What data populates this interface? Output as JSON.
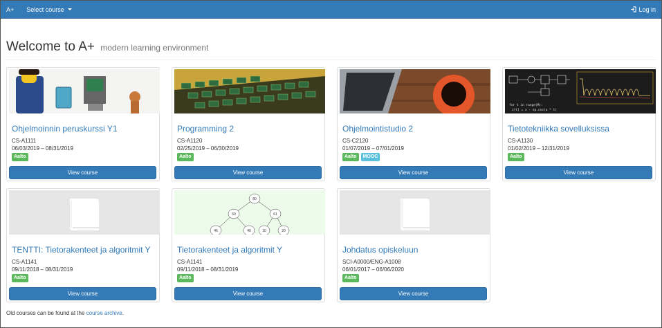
{
  "navbar": {
    "brand": "A+",
    "select_course": "Select course",
    "login": "Log in"
  },
  "header": {
    "title": "Welcome to A+",
    "subtitle": "modern learning environment"
  },
  "courses": [
    {
      "title": "Ohjelmoinnin peruskurssi Y1",
      "code": "CS-A1111",
      "dates": "06/03/2019 – 08/31/2019",
      "labels": [
        "Aalto"
      ],
      "button": "View course"
    },
    {
      "title": "Programming 2",
      "code": "CS-A1120",
      "dates": "02/25/2019 – 06/30/2019",
      "labels": [
        "Aalto"
      ],
      "button": "View course"
    },
    {
      "title": "Ohjelmointistudio 2",
      "code": "CS-C2120",
      "dates": "01/07/2019 – 07/01/2019",
      "labels": [
        "Aalto",
        "MOOC"
      ],
      "button": "View course"
    },
    {
      "title": "Tietotekniikka sovelluksissa",
      "code": "CS-A1130",
      "dates": "01/02/2019 – 12/31/2019",
      "labels": [
        "Aalto"
      ],
      "button": "View course"
    },
    {
      "title": "TENTTI: Tietorakenteet ja algoritmit Y",
      "code": "CS-A1141",
      "dates": "09/11/2018 – 08/31/2019",
      "labels": [
        "Aalto"
      ],
      "button": "View course"
    },
    {
      "title": "Tietorakenteet ja algoritmit Y",
      "code": "CS-A1141",
      "dates": "09/11/2018 – 08/31/2019",
      "labels": [
        "Aalto"
      ],
      "button": "View course"
    },
    {
      "title": "Johdatus opiskeluun",
      "code": "SCI-A0000/ENG-A1008",
      "dates": "06/01/2017 – 06/06/2020",
      "labels": [
        "Aalto"
      ],
      "button": "View course"
    }
  ],
  "thumbnail_text": {
    "code_line_1": "for t in range(M):",
    "code_line_2": "z[t] = x - np.cos(a * t)",
    "tree_nodes": [
      "80",
      "50",
      "61",
      "46",
      "40",
      "10",
      "20"
    ]
  },
  "footer": {
    "prefix": "Old courses can be found at the ",
    "link": "course archive",
    "suffix": "."
  },
  "colors": {
    "navbar": "#337ab7",
    "link": "#337ab7",
    "label_aalto": "#5cb85c",
    "label_mooc": "#5bc0de"
  },
  "icons": {
    "login": "sign-in-icon",
    "select_course": "caret-down-icon",
    "placeholder": "book-icon"
  }
}
